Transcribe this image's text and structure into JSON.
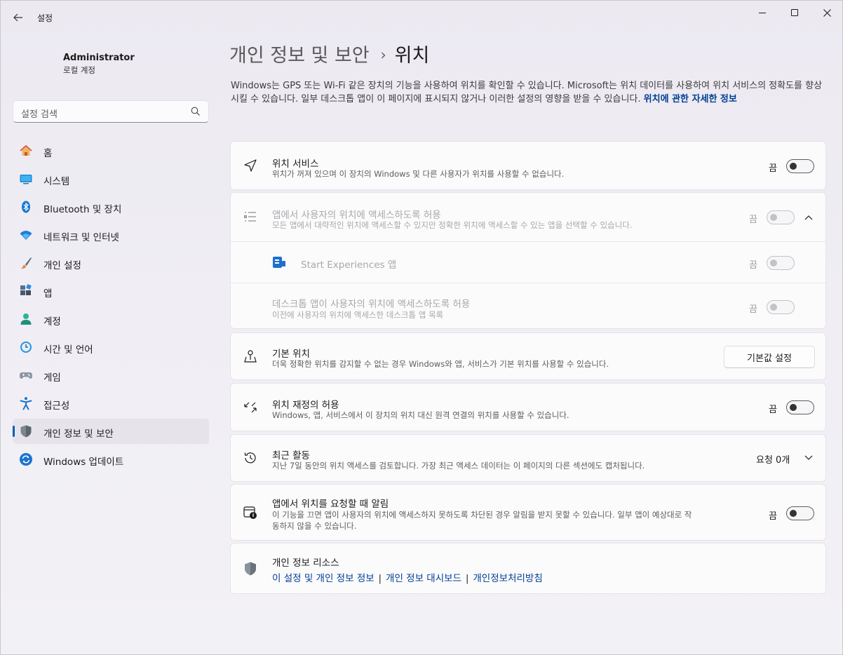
{
  "window": {
    "title": "설정",
    "back_icon": "back-arrow-icon"
  },
  "user": {
    "name": "Administrator",
    "account_type": "로컬 계정"
  },
  "search": {
    "placeholder": "설정 검색"
  },
  "nav": {
    "items": [
      {
        "label": "홈",
        "icon": "home-icon"
      },
      {
        "label": "시스템",
        "icon": "system-icon"
      },
      {
        "label": "Bluetooth 및 장치",
        "icon": "bluetooth-icon"
      },
      {
        "label": "네트워크 및 인터넷",
        "icon": "wifi-icon"
      },
      {
        "label": "개인 설정",
        "icon": "brush-icon"
      },
      {
        "label": "앱",
        "icon": "apps-icon"
      },
      {
        "label": "계정",
        "icon": "account-icon"
      },
      {
        "label": "시간 및 언어",
        "icon": "clock-icon"
      },
      {
        "label": "게임",
        "icon": "gamepad-icon"
      },
      {
        "label": "접근성",
        "icon": "accessibility-icon"
      },
      {
        "label": "개인 정보 및 보안",
        "icon": "shield-icon",
        "active": true
      },
      {
        "label": "Windows 업데이트",
        "icon": "update-icon"
      }
    ]
  },
  "breadcrumb": {
    "parent": "개인 정보 및 보안",
    "separator": "›",
    "current": "위치"
  },
  "description": {
    "text": "Windows는 GPS 또는 Wi-Fi 같은 장치의 기능을 사용하여 위치를 확인할 수 있습니다. Microsoft는 위치 데이터를 사용하여 위치 서비스의 정확도를 향상시킬 수 있습니다. 일부 데스크톱 앱이 이 페이지에 표시되지 않거나 이러한 설정의 영향을 받을 수 있습니다.",
    "link": "위치에 관한 자세한 정보"
  },
  "location_service": {
    "title": "위치 서비스",
    "subtitle": "위치가 꺼져 있으며 이 장치의 Windows 및 다른 사용자가 위치를 사용할 수 없습니다.",
    "state": "끔",
    "on": false
  },
  "app_access": {
    "title": "앱에서 사용자의 위치에 액세스하도록 허용",
    "subtitle": "모든 앱에서 대략적인 위치에 액세스할 수 있지만 정확한 위치에 액세스할 수 있는 앱을 선택할 수 있습니다.",
    "state": "끔",
    "on": false,
    "start_experiences": {
      "title": "Start Experiences 앱",
      "state": "끔",
      "on": false
    },
    "desktop_apps": {
      "title": "데스크톱 앱이 사용자의 위치에 액세스하도록 허용",
      "subtitle": "이전에 사용자의 위치에 액세스한 데스크톱 앱 목록",
      "state": "끔",
      "on": false
    }
  },
  "default_location": {
    "title": "기본 위치",
    "subtitle": "더욱 정확한 위치를 감지할 수 없는 경우 Windows와 앱, 서비스가 기본 위치를 사용할 수 있습니다.",
    "button": "기본값 설정"
  },
  "location_override": {
    "title": "위치 재정의 허용",
    "subtitle": "Windows, 앱, 서비스에서 이 장치의 위치 대신 원격 연결의 위치를 사용할 수 있습니다.",
    "state": "끔",
    "on": false
  },
  "recent_activity": {
    "title": "최근 활동",
    "subtitle": "지난 7일 동안의 위치 액세스를 검토합니다. 가장 최근 액세스 데이터는 이 페이지의 다른 섹션에도 캡처됩니다.",
    "count": "요청 0개"
  },
  "notify": {
    "title": "앱에서 위치를 요청할 때 알림",
    "subtitle_line1": "이 기능을 끄면 앱이 사용자의 위치에 액세스하지 못하도록 차단된 경우 알림을 받지 못할 수 있습니다. 일부 앱이 예상대로 작",
    "subtitle_line2": "동하지 않을 수 있습니다.",
    "state": "끔",
    "on": false
  },
  "privacy_resources": {
    "title": "개인 정보 리소스",
    "links": [
      "이 설정 및 개인 정보 정보",
      "개인 정보 대시보드",
      "개인정보처리방침"
    ]
  }
}
